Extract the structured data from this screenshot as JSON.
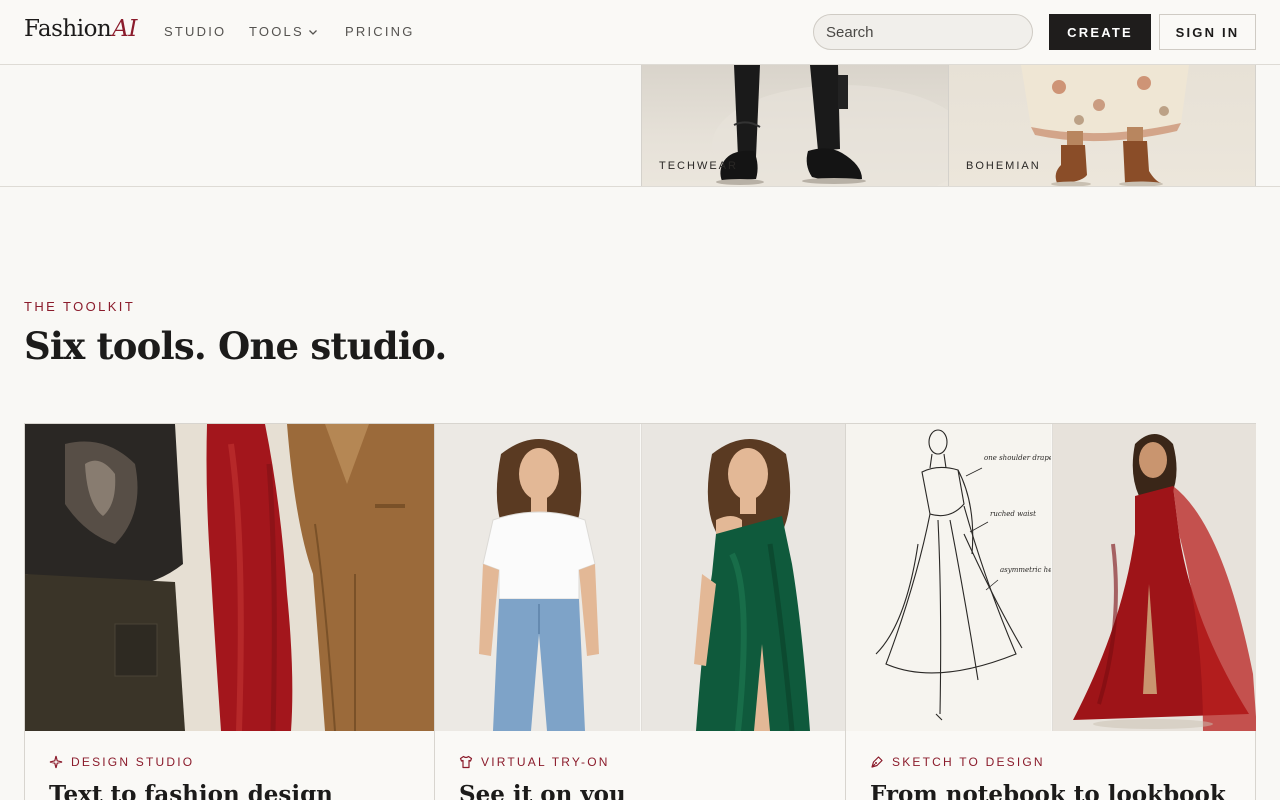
{
  "header": {
    "logo_main": "Fashion",
    "logo_accent": "AI",
    "nav": {
      "studio": "STUDIO",
      "tools": "TOOLS",
      "pricing": "PRICING"
    },
    "search_placeholder": "Search",
    "create_label": "CREATE",
    "signin_label": "SIGN IN"
  },
  "hero": {
    "tiles": [
      {
        "label": "TECHWEAR"
      },
      {
        "label": "BOHEMIAN"
      }
    ]
  },
  "toolkit": {
    "eyebrow": "THE TOOLKIT",
    "title": "Six tools. One studio.",
    "cards": [
      {
        "tag": "DESIGN STUDIO",
        "title": "Text to fashion design",
        "icon": "sparkle-icon"
      },
      {
        "tag": "VIRTUAL TRY-ON",
        "title": "See it on you",
        "icon": "shirt-icon"
      },
      {
        "tag": "SKETCH TO DESIGN",
        "title": "From notebook to lookbook",
        "icon": "pen-tool-icon"
      }
    ]
  },
  "sketch_notes": [
    "one shoulder drape",
    "ruched waist",
    "asymmetric hem"
  ],
  "colors": {
    "accent": "#8b1c2c",
    "background": "#f9f8f5",
    "button_dark": "#1f1d1c"
  }
}
